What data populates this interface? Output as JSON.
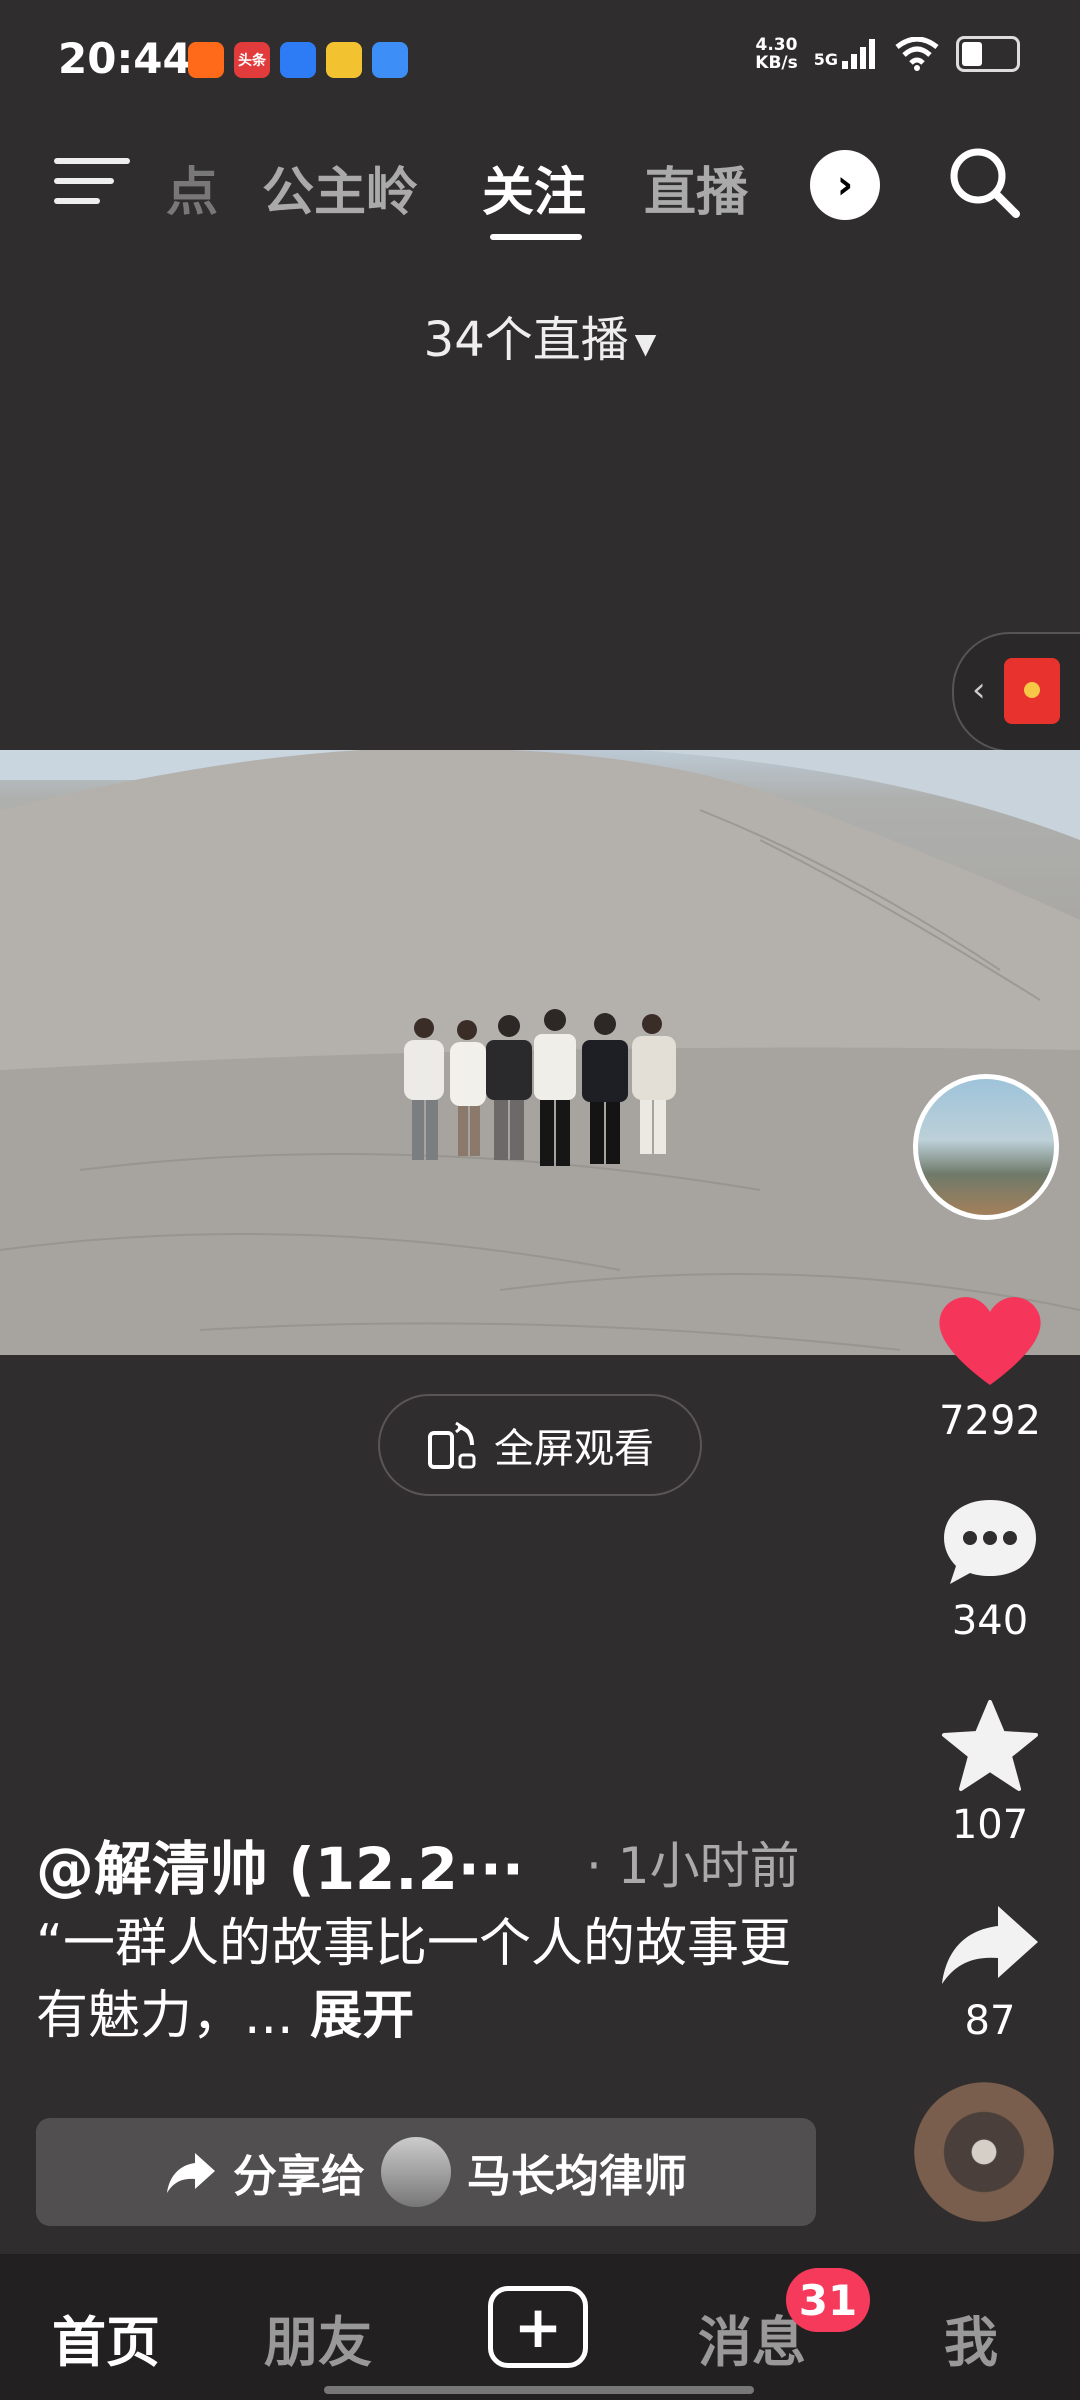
{
  "status_bar": {
    "time": "20:44",
    "net_speed_value": "4.30",
    "net_speed_unit": "KB/s",
    "network": "5G",
    "apps": [
      {
        "name": "kuaishou-icon",
        "label": "",
        "color": "#ff6a1a"
      },
      {
        "name": "toutiao-icon",
        "label": "头条",
        "color": "#e23b3b"
      },
      {
        "name": "app-blue-icon",
        "label": "",
        "color": "#2d7cf6"
      },
      {
        "name": "weibo-icon",
        "label": "",
        "color": "#f2c230"
      },
      {
        "name": "weather-icon",
        "label": "",
        "color": "#3e8ef7"
      }
    ]
  },
  "top_nav": {
    "tabs": [
      {
        "label": "点",
        "active": false
      },
      {
        "label": "公主岭",
        "active": false
      },
      {
        "label": "关注",
        "active": true
      },
      {
        "label": "直播",
        "active": false
      }
    ]
  },
  "live_count": "34个直播",
  "post": {
    "author": "@解清帅 (12.2···",
    "time": "· 1小时前",
    "caption": "“一群人的故事比一个人的故事更有魅力，... ",
    "expand_label": "展开"
  },
  "fullscreen_label": "全屏观看",
  "actions": {
    "likes": "7292",
    "comments": "340",
    "favorites": "107",
    "shares": "87"
  },
  "share_bar": {
    "prefix": "分享给",
    "target": "马长均律师"
  },
  "bottom_nav": {
    "home": "首页",
    "friends": "朋友",
    "messages": "消息",
    "messages_badge": "31",
    "me": "我"
  },
  "colors": {
    "background": "#302d2e",
    "like": "#f5355a",
    "badge": "#f53a5c"
  }
}
